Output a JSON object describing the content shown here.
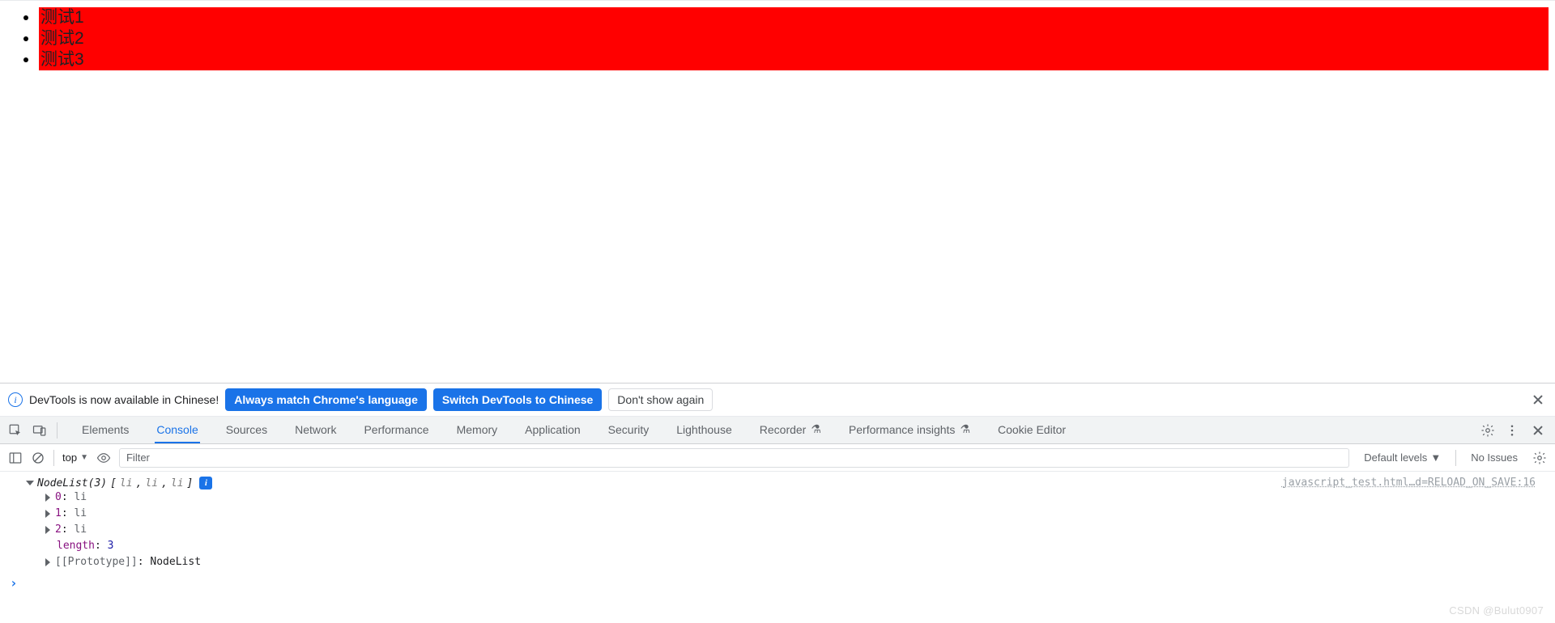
{
  "page": {
    "items": [
      "测试1",
      "测试2",
      "测试3"
    ]
  },
  "infobar": {
    "message": "DevTools is now available in Chinese!",
    "btn_match": "Always match Chrome's language",
    "btn_switch": "Switch DevTools to Chinese",
    "btn_dismiss": "Don't show again"
  },
  "tabs": {
    "items": [
      {
        "label": "Elements"
      },
      {
        "label": "Console",
        "active": true
      },
      {
        "label": "Sources"
      },
      {
        "label": "Network"
      },
      {
        "label": "Performance"
      },
      {
        "label": "Memory"
      },
      {
        "label": "Application"
      },
      {
        "label": "Security"
      },
      {
        "label": "Lighthouse"
      },
      {
        "label": "Recorder",
        "flask": true
      },
      {
        "label": "Performance insights",
        "flask": true
      },
      {
        "label": "Cookie Editor"
      }
    ]
  },
  "console_toolbar": {
    "context": "top",
    "filter_placeholder": "Filter",
    "levels": "Default levels",
    "issues": "No Issues"
  },
  "log": {
    "header_prefix": "NodeList(3)",
    "header_items": [
      "li",
      "li",
      "li"
    ],
    "source_link": "javascript_test.html…d=RELOAD_ON_SAVE:16",
    "entries": [
      {
        "key": "0",
        "val": "li"
      },
      {
        "key": "1",
        "val": "li"
      },
      {
        "key": "2",
        "val": "li"
      }
    ],
    "length_label": "length",
    "length_value": "3",
    "proto_label": "[[Prototype]]",
    "proto_value": "NodeList"
  },
  "watermark": "CSDN @Bulut0907"
}
